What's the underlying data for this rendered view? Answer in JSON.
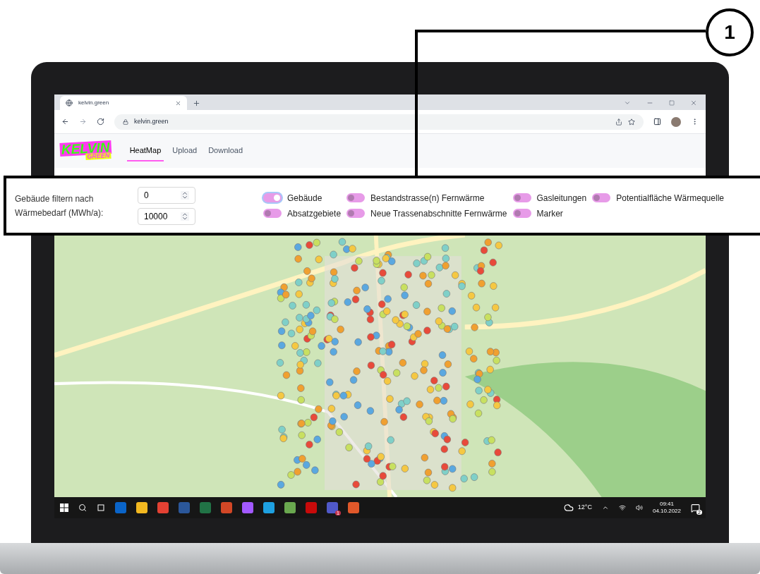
{
  "callout": {
    "number": "1"
  },
  "browser": {
    "tab_title": "kelvin.green",
    "url": "kelvin.green"
  },
  "app": {
    "logo": {
      "line1": "KELVIN",
      "line2": "GREEN"
    },
    "nav": [
      {
        "label": "HeatMap",
        "selected": true
      },
      {
        "label": "Upload",
        "selected": false
      },
      {
        "label": "Download",
        "selected": false
      }
    ]
  },
  "filter": {
    "label": "Gebäude filtern nach Wärmebedarf (MWh/a):",
    "min": "0",
    "max": "10000"
  },
  "layers": [
    {
      "label": "Gebäude",
      "on": true
    },
    {
      "label": "Absatzgebiete",
      "on": false
    },
    {
      "label": "Bestandstrasse(n) Fernwärme",
      "on": false
    },
    {
      "label": "Neue Trassenabschnitte Fernwärme",
      "on": false
    },
    {
      "label": "Gasleitungen",
      "on": false
    },
    {
      "label": "Marker",
      "on": false
    },
    {
      "label": "Potentialfläche Wärmequelle",
      "on": false
    }
  ],
  "taskbar": {
    "apps": [
      {
        "color": "#0a64c8"
      },
      {
        "color": "#f2b820"
      },
      {
        "color": "#e34133"
      },
      {
        "color": "#2b579a"
      },
      {
        "color": "#217346"
      },
      {
        "color": "#d24726"
      },
      {
        "color": "#a259ff"
      },
      {
        "color": "#1ea0e0"
      },
      {
        "color": "#6aa84f"
      },
      {
        "color": "#c80a0a"
      },
      {
        "color": "#5059c9"
      },
      {
        "color": "#e0582a"
      }
    ],
    "app_badge": "1",
    "temperature": "12°C",
    "time": "09:41",
    "date": "04.10.2022",
    "notifications": "2"
  }
}
